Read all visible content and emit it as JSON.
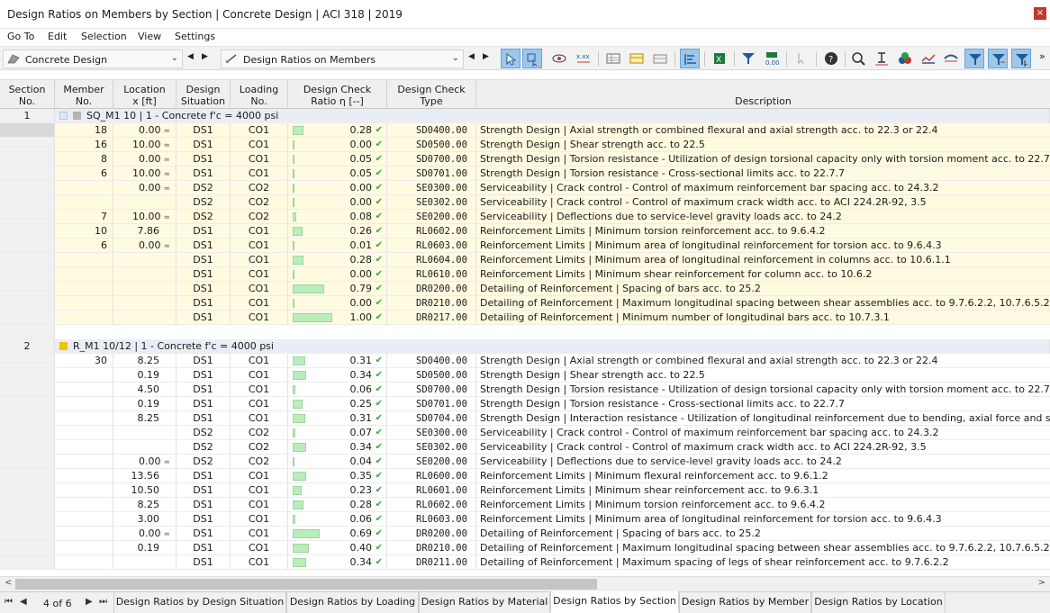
{
  "window": {
    "title": "Design Ratios on Members by Section | Concrete Design | ACI 318 | 2019",
    "close": "×"
  },
  "menu": [
    "Go To",
    "Edit",
    "Selection",
    "View",
    "Settings"
  ],
  "toolbar": {
    "module_combo": "Concrete Design",
    "result_combo": "Design Ratios on Members",
    "nav_prev": "◀",
    "nav_next": "▶",
    "dropdown": "⌄",
    "overflow": "»"
  },
  "colors": {
    "section1_marker": "#b3b3b3",
    "section2_marker": "#f2c200",
    "bar_fill": "#b9eebb",
    "check": "#3aa53a"
  },
  "columns": [
    {
      "key": "section",
      "label": "Section\nNo."
    },
    {
      "key": "member",
      "label": "Member\nNo."
    },
    {
      "key": "location",
      "label": "Location\nx [ft]"
    },
    {
      "key": "situation",
      "label": "Design\nSituation"
    },
    {
      "key": "loading",
      "label": "Loading\nNo."
    },
    {
      "key": "ratio",
      "label": "Design Check\nRatio η [--]"
    },
    {
      "key": "type",
      "label": "Design Check\nType"
    },
    {
      "key": "description",
      "label": "\nDescription"
    }
  ],
  "sections": [
    {
      "no": "1",
      "title": "SQ_M1 10 | 1 - Concrete f'c = 4000 psi",
      "marker_color": "#b3b3b3",
      "rows": [
        {
          "member": "18",
          "location": "0.00",
          "sym": "≖",
          "situation": "DS1",
          "loading": "CO1",
          "ratio": "0.28",
          "type": "SD0400.00",
          "description": "Strength Design | Axial strength or combined flexural and axial strength acc. to 22.3 or 22.4"
        },
        {
          "member": "16",
          "location": "10.00",
          "sym": "≖",
          "situation": "DS1",
          "loading": "CO1",
          "ratio": "0.00",
          "type": "SD0500.00",
          "description": "Strength Design | Shear strength acc. to 22.5"
        },
        {
          "member": "8",
          "location": "0.00",
          "sym": "≖",
          "situation": "DS1",
          "loading": "CO1",
          "ratio": "0.05",
          "type": "SD0700.00",
          "description": "Strength Design | Torsion resistance - Utilization of design torsional capacity only with torsion moment acc. to 22.7"
        },
        {
          "member": "6",
          "location": "10.00",
          "sym": "≖",
          "situation": "DS1",
          "loading": "CO1",
          "ratio": "0.05",
          "type": "SD0701.00",
          "description": "Strength Design | Torsion resistance - Cross-sectional limits acc. to 22.7.7"
        },
        {
          "member": "",
          "location": "0.00",
          "sym": "≖",
          "situation": "DS2",
          "loading": "CO2",
          "ratio": "0.00",
          "type": "SE0300.00",
          "description": "Serviceability | Crack control - Control of maximum reinforcement bar spacing acc. to 24.3.2"
        },
        {
          "member": "",
          "location": "",
          "sym": "",
          "situation": "DS2",
          "loading": "CO2",
          "ratio": "0.00",
          "type": "SE0302.00",
          "description": "Serviceability | Crack control - Control of maximum crack width acc. to ACI 224.2R-92, 3.5"
        },
        {
          "member": "7",
          "location": "10.00",
          "sym": "≖",
          "situation": "DS2",
          "loading": "CO2",
          "ratio": "0.08",
          "type": "SE0200.00",
          "description": "Serviceability | Deflections due to service-level gravity loads acc. to 24.2"
        },
        {
          "member": "10",
          "location": "7.86",
          "sym": "",
          "situation": "DS1",
          "loading": "CO1",
          "ratio": "0.26",
          "type": "RL0602.00",
          "description": "Reinforcement Limits | Minimum torsion reinforcement acc. to 9.6.4.2"
        },
        {
          "member": "6",
          "location": "0.00",
          "sym": "≖",
          "situation": "DS1",
          "loading": "CO1",
          "ratio": "0.01",
          "type": "RL0603.00",
          "description": "Reinforcement Limits | Minimum area of longitudinal reinforcement for torsion acc. to 9.6.4.3"
        },
        {
          "member": "",
          "location": "",
          "sym": "",
          "situation": "DS1",
          "loading": "CO1",
          "ratio": "0.28",
          "type": "RL0604.00",
          "description": "Reinforcement Limits | Minimum area of longitudinal reinforcement in columns acc. to 10.6.1.1"
        },
        {
          "member": "",
          "location": "",
          "sym": "",
          "situation": "DS1",
          "loading": "CO1",
          "ratio": "0.00",
          "type": "RL0610.00",
          "description": "Reinforcement Limits | Minimum shear reinforcement for column acc. to 10.6.2"
        },
        {
          "member": "",
          "location": "",
          "sym": "",
          "situation": "DS1",
          "loading": "CO1",
          "ratio": "0.79",
          "type": "DR0200.00",
          "description": "Detailing of Reinforcement | Spacing of bars acc. to 25.2"
        },
        {
          "member": "",
          "location": "",
          "sym": "",
          "situation": "DS1",
          "loading": "CO1",
          "ratio": "0.00",
          "type": "DR0210.00",
          "description": "Detailing of Reinforcement | Maximum longitudinal spacing between shear assemblies acc. to 9.7.6.2.2, 10.7.6.5.2"
        },
        {
          "member": "",
          "location": "",
          "sym": "",
          "situation": "DS1",
          "loading": "CO1",
          "ratio": "1.00",
          "type": "DR0217.00",
          "description": "Detailing of Reinforcement | Minimum number of longitudinal bars acc. to 10.7.3.1"
        }
      ]
    },
    {
      "no": "2",
      "title": "R_M1 10/12 | 1 - Concrete f'c = 4000 psi",
      "marker_color": "#f2c200",
      "rows": [
        {
          "member": "30",
          "location": "8.25",
          "sym": "",
          "situation": "DS1",
          "loading": "CO1",
          "ratio": "0.31",
          "type": "SD0400.00",
          "description": "Strength Design | Axial strength or combined flexural and axial strength acc. to 22.3 or 22.4"
        },
        {
          "member": "",
          "location": "0.19",
          "sym": "",
          "situation": "DS1",
          "loading": "CO1",
          "ratio": "0.34",
          "type": "SD0500.00",
          "description": "Strength Design | Shear strength acc. to 22.5"
        },
        {
          "member": "",
          "location": "4.50",
          "sym": "",
          "situation": "DS1",
          "loading": "CO1",
          "ratio": "0.06",
          "type": "SD0700.00",
          "description": "Strength Design | Torsion resistance - Utilization of design torsional capacity only with torsion moment acc. to 22.7"
        },
        {
          "member": "",
          "location": "0.19",
          "sym": "",
          "situation": "DS1",
          "loading": "CO1",
          "ratio": "0.25",
          "type": "SD0701.00",
          "description": "Strength Design | Torsion resistance - Cross-sectional limits acc. to 22.7.7"
        },
        {
          "member": "",
          "location": "8.25",
          "sym": "",
          "situation": "DS1",
          "loading": "CO1",
          "ratio": "0.31",
          "type": "SD0704.00",
          "description": "Strength Design | Interaction resistance - Utilization of longitudinal reinforcement due to bending, axial force and shear ac"
        },
        {
          "member": "",
          "location": "",
          "sym": "",
          "situation": "DS2",
          "loading": "CO2",
          "ratio": "0.07",
          "type": "SE0300.00",
          "description": "Serviceability | Crack control - Control of maximum reinforcement bar spacing acc. to 24.3.2"
        },
        {
          "member": "",
          "location": "",
          "sym": "",
          "situation": "DS2",
          "loading": "CO2",
          "ratio": "0.34",
          "type": "SE0302.00",
          "description": "Serviceability | Crack control - Control of maximum crack width acc. to ACI 224.2R-92, 3.5"
        },
        {
          "member": "",
          "location": "0.00",
          "sym": "≖",
          "situation": "DS2",
          "loading": "CO2",
          "ratio": "0.04",
          "type": "SE0200.00",
          "description": "Serviceability | Deflections due to service-level gravity loads acc. to 24.2"
        },
        {
          "member": "",
          "location": "13.56",
          "sym": "",
          "situation": "DS1",
          "loading": "CO1",
          "ratio": "0.35",
          "type": "RL0600.00",
          "description": "Reinforcement Limits | Minimum flexural reinforcement acc. to 9.6.1.2"
        },
        {
          "member": "",
          "location": "10.50",
          "sym": "",
          "situation": "DS1",
          "loading": "CO1",
          "ratio": "0.23",
          "type": "RL0601.00",
          "description": "Reinforcement Limits | Minimum shear reinforcement acc. to 9.6.3.1"
        },
        {
          "member": "",
          "location": "8.25",
          "sym": "",
          "situation": "DS1",
          "loading": "CO1",
          "ratio": "0.28",
          "type": "RL0602.00",
          "description": "Reinforcement Limits | Minimum torsion reinforcement acc. to 9.6.4.2"
        },
        {
          "member": "",
          "location": "3.00",
          "sym": "",
          "situation": "DS1",
          "loading": "CO1",
          "ratio": "0.06",
          "type": "RL0603.00",
          "description": "Reinforcement Limits | Minimum area of longitudinal reinforcement for torsion acc. to 9.6.4.3"
        },
        {
          "member": "",
          "location": "0.00",
          "sym": "≖",
          "situation": "DS1",
          "loading": "CO1",
          "ratio": "0.69",
          "type": "DR0200.00",
          "description": "Detailing of Reinforcement | Spacing of bars acc. to 25.2"
        },
        {
          "member": "",
          "location": "0.19",
          "sym": "",
          "situation": "DS1",
          "loading": "CO1",
          "ratio": "0.40",
          "type": "DR0210.00",
          "description": "Detailing of Reinforcement | Maximum longitudinal spacing between shear assemblies acc. to 9.7.6.2.2, 10.7.6.5.2"
        },
        {
          "member": "",
          "location": "",
          "sym": "",
          "situation": "DS1",
          "loading": "CO1",
          "ratio": "0.34",
          "type": "DR0211.00",
          "description": "Detailing of Reinforcement | Maximum spacing of legs of shear reinforcement acc. to 9.7.6.2.2"
        }
      ]
    }
  ],
  "scroll": {
    "left": "<",
    "right": ">"
  },
  "pager": {
    "first": "⏮",
    "prev": "◀",
    "info": "4 of 6",
    "next": "▶",
    "last": "⏭"
  },
  "tabs": [
    {
      "label": "Design Ratios by Design Situation",
      "active": false
    },
    {
      "label": "Design Ratios by Loading",
      "active": false
    },
    {
      "label": "Design Ratios by Material",
      "active": false
    },
    {
      "label": "Design Ratios by Section",
      "active": true
    },
    {
      "label": "Design Ratios by Member",
      "active": false
    },
    {
      "label": "Design Ratios by Location",
      "active": false
    }
  ]
}
